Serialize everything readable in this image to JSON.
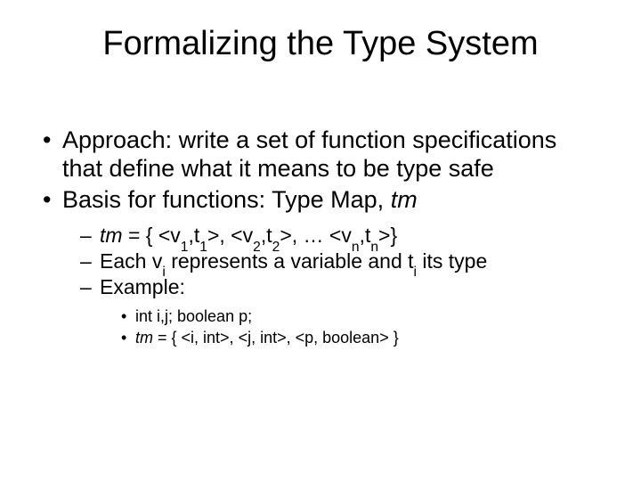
{
  "title": "Formalizing the Type System",
  "bullets": {
    "b1": "Approach: write a set of function specifications that define what it means to be type safe",
    "b2_pre": "Basis for functions: Type Map, ",
    "b2_it": "tm",
    "s1_it1": "tm",
    "s1_mid": " = { <v",
    "s1_s1": "1",
    "s1_a": ",t",
    "s1_s2": "1",
    "s1_b": ">, <v",
    "s1_s3": "2",
    "s1_c": ",t",
    "s1_s4": "2",
    "s1_d": ">, … <v",
    "s1_s5": "n",
    "s1_e": ",t",
    "s1_s6": "n",
    "s1_f": ">}",
    "s2_a": "Each v",
    "s2_s1": "i",
    "s2_b": " represents a variable and t",
    "s2_s2": "i",
    "s2_c": " its type",
    "s3": "Example:",
    "t1": "int i,j; boolean p;",
    "t2_it": "tm",
    "t2_rest": " = { <i, int>, <j, int>, <p, boolean> }"
  }
}
